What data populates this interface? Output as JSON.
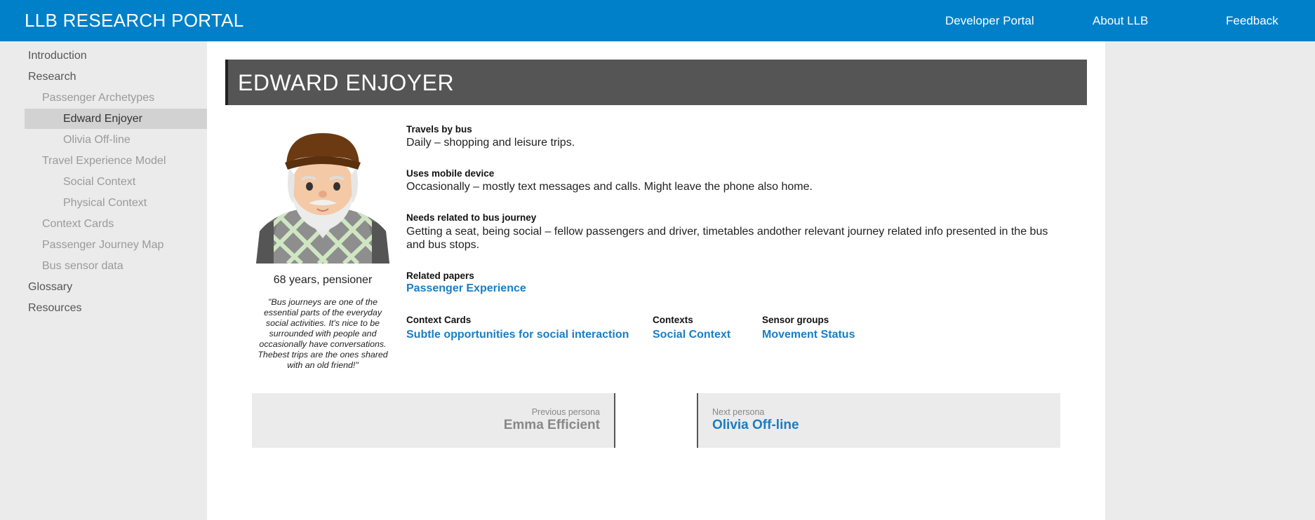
{
  "header": {
    "brand": "LLB RESEARCH PORTAL",
    "nav": [
      {
        "label": "Developer Portal"
      },
      {
        "label": "About LLB"
      },
      {
        "label": "Feedback"
      }
    ]
  },
  "sidebar": {
    "items": [
      {
        "label": "Introduction"
      },
      {
        "label": "Research"
      },
      {
        "label": "Passenger Archetypes"
      },
      {
        "label": "Edward Enjoyer"
      },
      {
        "label": "Olivia Off-line"
      },
      {
        "label": "Travel Experience Model"
      },
      {
        "label": "Social Context"
      },
      {
        "label": "Physical Context"
      },
      {
        "label": "Context Cards"
      },
      {
        "label": "Passenger Journey Map"
      },
      {
        "label": "Bus sensor data"
      },
      {
        "label": "Glossary"
      },
      {
        "label": "Resources"
      }
    ]
  },
  "persona": {
    "name": "EDWARD ENJOYER",
    "age_line": "68 years, pensioner",
    "quote": "\"Bus journeys are one of the essential parts of the everyday social activities. It's nice to be surrounded with people and occasionally have conversations. Thebest trips are the ones shared with an old friend!\"",
    "avatar_icon": "elderly-man-avatar",
    "facts": [
      {
        "label": "Travels by bus",
        "text": "Daily – shopping and leisure trips."
      },
      {
        "label": "Uses mobile device",
        "text": "Occasionally – mostly text messages and calls. Might leave the phone also home."
      },
      {
        "label": "Needs related to bus journey",
        "text": "Getting a seat, being social – fellow passengers and driver, timetables andother relevant journey related info presented in the bus and bus stops."
      }
    ],
    "related_papers": {
      "label": "Related papers",
      "link": "Passenger Experience"
    },
    "context_cards": {
      "label": "Context Cards",
      "link": "Subtle opportunities for social interaction"
    },
    "contexts": {
      "label": "Contexts",
      "link": "Social Context"
    },
    "sensor_groups": {
      "label": "Sensor groups",
      "link": "Movement Status"
    }
  },
  "pager": {
    "prev": {
      "small": "Previous persona",
      "name": "Emma Efficient"
    },
    "next": {
      "small": "Next persona",
      "name": "Olivia Off-line"
    }
  },
  "colors": {
    "header": "#0080c8",
    "link": "#1a7dc3",
    "title_bar": "#555555",
    "sidebar_active": "#d2d2d2"
  }
}
